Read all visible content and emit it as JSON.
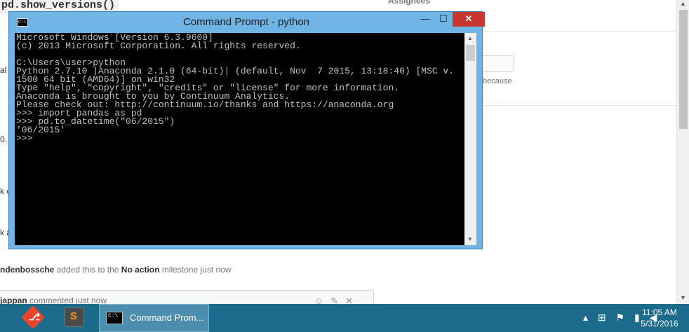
{
  "background_page": {
    "code_title": "pd.show_versions()",
    "sidebar_heading": "Assignees",
    "sidebar_because": "because",
    "fragments": [
      "al",
      "0.",
      "k c",
      "k a"
    ],
    "event": {
      "actor": "ndenbossche",
      "text": "added this to the",
      "milestone": "No action",
      "suffix": "milestone just now"
    },
    "comment": {
      "author": "jappan",
      "text": "commented just now"
    }
  },
  "console_window": {
    "title": "Command Prompt - python",
    "controls": {
      "minimize": "—",
      "maximize": "☐",
      "close": "✕"
    },
    "icon_text": "C:\\",
    "lines": [
      "Microsoft Windows [Version 6.3.9600]",
      "(c) 2013 Microsoft Corporation. All rights reserved.",
      "",
      "C:\\Users\\user>python",
      "Python 2.7.10 |Anaconda 2.1.0 (64-bit)| (default, Nov  7 2015, 13:18:40) [MSC v.",
      "1500 64 bit (AMD64)] on win32",
      "Type \"help\", \"copyright\", \"credits\" or \"license\" for more information.",
      "Anaconda is brought to you by Continuum Analytics.",
      "Please check out: http://continuum.io/thanks and https://anaconda.org",
      ">>> import pandas as pd",
      ">>> pd.to_datetime(\"06/2015\")",
      "'06/2015'",
      ">>>"
    ]
  },
  "taskbar": {
    "cmd_label": "Command Prom...",
    "sublime_glyph": "S",
    "git_glyph": "⎇",
    "cmd_icon_text": "C:\\",
    "tray_icons": [
      "up-arrow-icon",
      "windows-flag-icon",
      "flag-icon",
      "signal-icon",
      "speaker-icon"
    ],
    "tray_glyphs": "▴ ⊞ ⚑ ▮ ◀",
    "time": "11:05 AM",
    "date": "5/31/2016"
  }
}
